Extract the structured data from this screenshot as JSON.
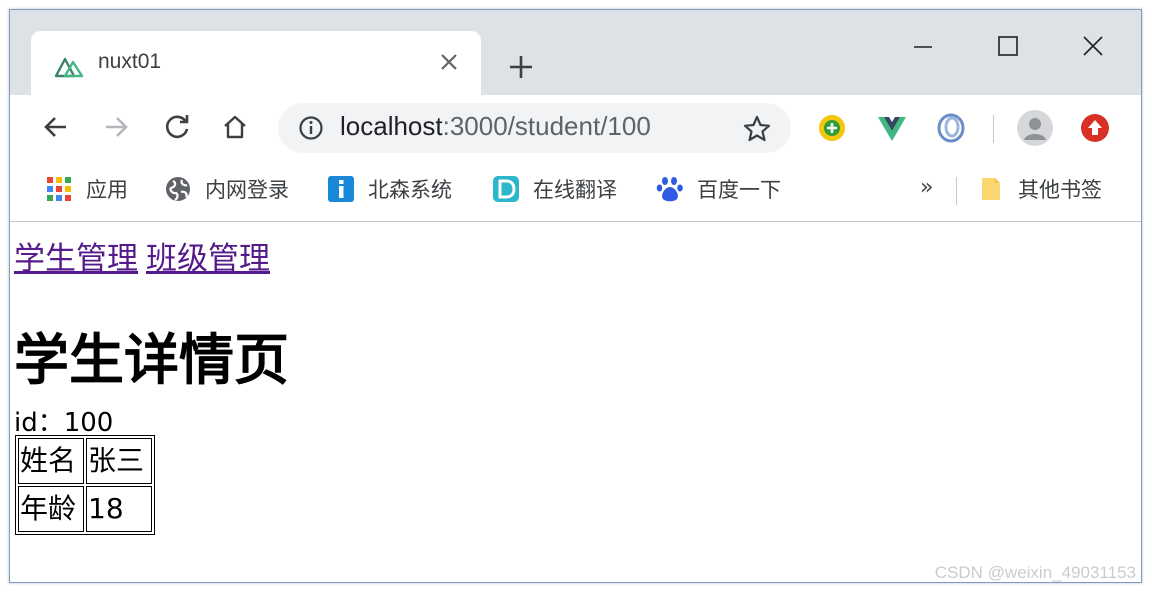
{
  "tab": {
    "title": "nuxt01"
  },
  "address": {
    "host": "localhost",
    "path": ":3000/student/100"
  },
  "bookmarks": [
    {
      "label": "应用",
      "icon": "apps-grid-icon"
    },
    {
      "label": "内网登录",
      "icon": "globe-icon"
    },
    {
      "label": "北森系统",
      "icon": "info-icon"
    },
    {
      "label": "在线翻译",
      "icon": "d-logo-icon"
    },
    {
      "label": "百度一下",
      "icon": "baidu-paw-icon"
    }
  ],
  "bookmarks_more": "»",
  "other_bookmarks": {
    "label": "其他书签",
    "icon": "folder-icon"
  },
  "page": {
    "nav": [
      {
        "label": "学生管理"
      },
      {
        "label": "班级管理"
      }
    ],
    "heading": "学生详情页",
    "id_label": "id：100",
    "table": [
      [
        "姓名",
        "张三"
      ],
      [
        "年龄",
        "18"
      ]
    ]
  },
  "watermark": "CSDN @weixin_49031153",
  "colors": {
    "tabstrip": "#dee1e6",
    "omnibox": "#f1f3f4",
    "visited_link": "#551a8b"
  }
}
